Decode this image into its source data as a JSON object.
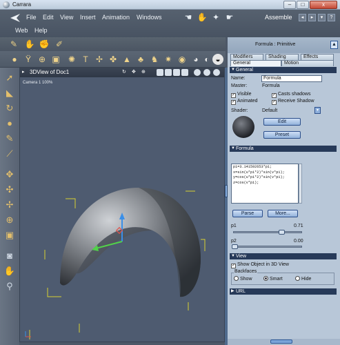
{
  "window": {
    "title": "Carrara",
    "min": "–",
    "max": "□",
    "close": "x"
  },
  "menu": {
    "items": [
      "File",
      "Edit",
      "View",
      "Insert",
      "Animation",
      "Windows"
    ],
    "items2": [
      "Web",
      "Help"
    ],
    "room": "Assemble",
    "room_icons": [
      "hand-icon",
      "hand-open-icon",
      "magic-wand-icon",
      "hand-point-icon"
    ]
  },
  "toolbar": {
    "row1_icons": [
      "lasso-icon",
      "hand-icon",
      "grab-icon",
      "paint-icon"
    ],
    "row2_icons": [
      "sphere-icon",
      "goblet-icon",
      "globe-icon",
      "cube-icon",
      "gear-icon",
      "text-icon",
      "pin-icon",
      "plant-icon",
      "terrain-icon",
      "tree-icon",
      "figure-icon",
      "light-icon",
      "spot-icon",
      "bulb-icon",
      "camera-icon",
      "blob-icon",
      "planet-icon",
      "fog-icon"
    ]
  },
  "left_tools": [
    "select-arrow-icon",
    "move-icon",
    "rotate-icon",
    "sphere-tool-icon",
    "scale-icon",
    "bone-icon",
    "pan-icon",
    "move-3d-icon",
    "orbit-icon",
    "dolly-icon",
    "cube-tool-icon",
    "camera-tool-icon",
    "hand-tool-icon",
    "zoom-icon"
  ],
  "viewport": {
    "title": "3DView of Doc1",
    "camera": "Camera 1 100%"
  },
  "panel": {
    "header": "Formula : Primitive",
    "tabs_top": [
      "Modifiers",
      "Shading",
      "Effects"
    ],
    "tabs_bottom": [
      "General",
      "Motion"
    ],
    "general": {
      "section": "General",
      "name_label": "Name:",
      "name_value": "Formula",
      "master_label": "Master:",
      "master_value": "Formula",
      "visible": "Visible",
      "casts_shadows": "Casts shadows",
      "animated": "Animated",
      "receive_shadow": "Receive Shadow",
      "shader_label": "Shader:",
      "shader_value": "Default",
      "edit": "Edit",
      "preset": "Preset"
    },
    "formula": {
      "section": "Formula",
      "lines": [
        "pi=3.141592653*p1;",
        "x=sin(u*pi*2)*sin(v*pi);",
        "y=cos(u*pi*2)*sin(v*pi);",
        "z=cos(v*pi);"
      ],
      "parse": "Parse",
      "more": "More...",
      "p1_label": "p1",
      "p1_value": "0.71",
      "p2_label": "p2",
      "p2_value": "0.00"
    },
    "view": {
      "section": "View",
      "show_object": "Show Object in 3D View",
      "backfaces": "Backfaces",
      "show": "Show",
      "smart": "Smart",
      "hide": "Hide"
    },
    "url": {
      "section": "URL"
    }
  },
  "colors": {
    "viewport_bg": "#4e5b70",
    "panel_bg": "#b8c7d8",
    "section_bg": "#273a59",
    "accent_blue": "#93b3da"
  }
}
